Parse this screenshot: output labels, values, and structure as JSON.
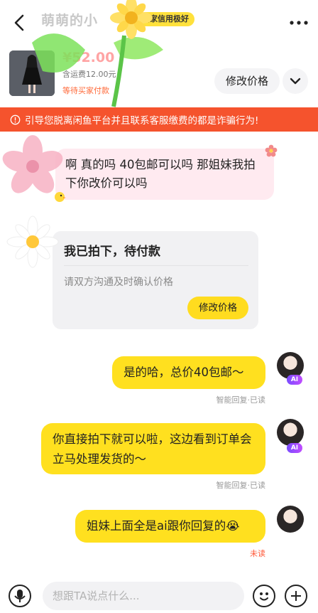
{
  "header": {
    "title_name": "萌萌的小",
    "credit_badge": "买家信用极好",
    "back_icon": "chevron-left-icon",
    "more_icon": "more-dots-icon"
  },
  "product": {
    "price": "¥52.00",
    "shipping": "含运费12.00元",
    "status": "等待买家付款",
    "modify_price_label": "修改价格",
    "chevron_icon": "chevron-down-icon"
  },
  "warning": {
    "icon": "alert-circle-icon",
    "text": "引导您脱离闲鱼平台并且联系客服缴费的都是诈骗行为!"
  },
  "messages": [
    {
      "side": "left",
      "text": "啊 真的吗 40包邮可以吗 那姐妹我拍下你改价可以吗"
    },
    {
      "side": "left",
      "type": "card",
      "title": "我已拍下，待付款",
      "subtitle": "请双方沟通及时确认价格",
      "button": "修改价格"
    },
    {
      "side": "right",
      "text": "是的哈，总价40包邮～",
      "meta": "智能回复·已读",
      "ai": "AI"
    },
    {
      "side": "right",
      "text": "你直接拍下就可以啦，这边看到订单会立马处理发货的～",
      "meta": "智能回复·已读",
      "ai": "AI"
    },
    {
      "side": "right",
      "text": "姐妹上面全是ai跟你回复的😭",
      "meta": "未读"
    }
  ],
  "input": {
    "placeholder": "想跟TA说点什么...",
    "value": ""
  },
  "colors": {
    "accent_yellow": "#ffe01f",
    "warning_bg": "#f5532d",
    "left_bubble_bg": "#ffeaf0",
    "card_bg": "#f1f1f3"
  }
}
